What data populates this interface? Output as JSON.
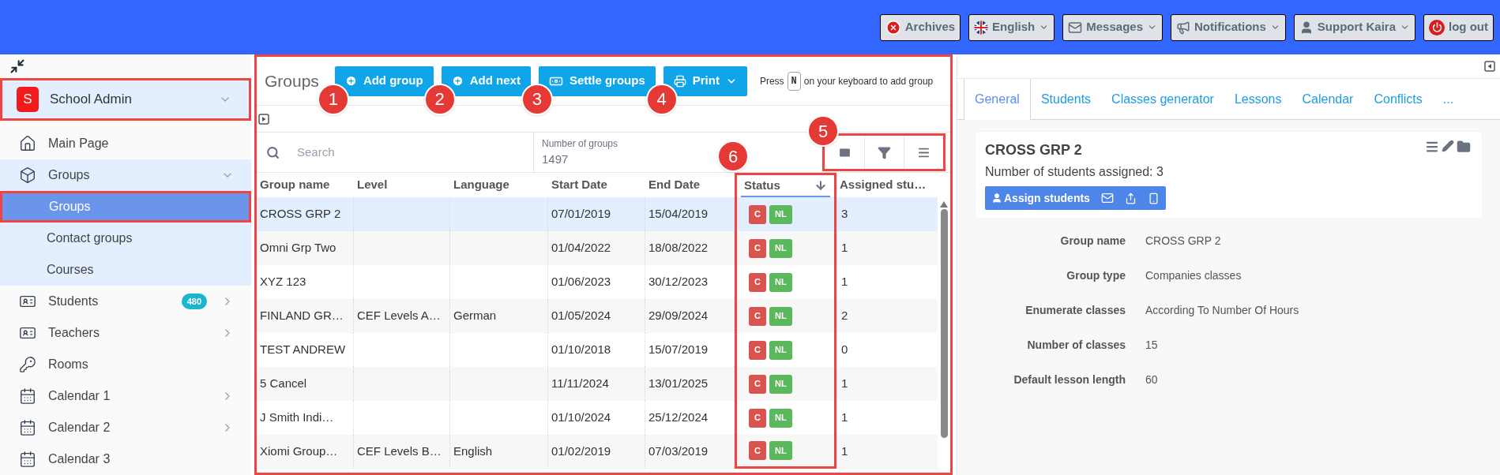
{
  "top_bar": {
    "buttons": [
      {
        "kind": "archives",
        "label": "Archives",
        "dropdown": false
      },
      {
        "kind": "language",
        "label": "English",
        "dropdown": true
      },
      {
        "kind": "messages",
        "label": "Messages",
        "dropdown": true
      },
      {
        "kind": "notifications",
        "label": "Notifications",
        "dropdown": true
      },
      {
        "kind": "user",
        "label": "Support Kaira",
        "dropdown": true
      },
      {
        "kind": "logout",
        "label": "log out",
        "dropdown": false
      }
    ]
  },
  "sidebar": {
    "header": {
      "initial": "S",
      "title": "School Admin",
      "highlighted": true
    },
    "items": [
      {
        "kind": "home",
        "label": "Main Page"
      },
      {
        "kind": "box",
        "label": "Groups",
        "expanded": true,
        "children": [
          {
            "label": "Groups",
            "selected": true,
            "highlighted": true
          },
          {
            "label": "Contact groups",
            "selected": false,
            "highlighted": false
          },
          {
            "label": "Courses",
            "selected": false,
            "highlighted": false
          }
        ]
      },
      {
        "kind": "card",
        "label": "Students",
        "badge": "480",
        "expanded": false
      },
      {
        "kind": "card",
        "label": "Teachers",
        "expanded": false
      },
      {
        "kind": "key",
        "label": "Rooms"
      },
      {
        "kind": "calendar",
        "label": "Calendar 1",
        "expanded": false
      },
      {
        "kind": "calendar",
        "label": "Calendar 2",
        "expanded": false
      },
      {
        "kind": "calendar",
        "label": "Calendar 3"
      }
    ]
  },
  "groups_panel": {
    "highlighted": true,
    "title": "Groups",
    "buttons": [
      {
        "kind": "add",
        "label": "Add group",
        "callout": "1",
        "dropdown": false
      },
      {
        "kind": "add",
        "label": "Add next",
        "callout": "2",
        "dropdown": false
      },
      {
        "kind": "money",
        "label": "Settle groups",
        "callout": "3",
        "dropdown": false
      },
      {
        "kind": "print",
        "label": "Print",
        "callout": "4",
        "dropdown": true
      }
    ],
    "hint": {
      "before": "Press",
      "key": "N",
      "after": "on your keyboard to add group"
    },
    "search": {
      "placeholder": "Search"
    },
    "count": {
      "label": "Number of groups",
      "value": "1497"
    },
    "tools": {
      "highlighted": true,
      "callout": "5"
    },
    "table": {
      "columns": [
        {
          "label": "Group name",
          "sorted": false,
          "highlighted": false
        },
        {
          "label": "Level",
          "sorted": false,
          "highlighted": false
        },
        {
          "label": "Language",
          "sorted": false,
          "highlighted": false
        },
        {
          "label": "Start Date",
          "sorted": false,
          "highlighted": false
        },
        {
          "label": "End Date",
          "sorted": false,
          "highlighted": false
        },
        {
          "label": "Status",
          "sorted": true,
          "highlighted": true,
          "callout": "6"
        },
        {
          "label": "Assigned stu…",
          "sorted": false,
          "highlighted": false
        }
      ],
      "rows": [
        {
          "selected": true,
          "cells": [
            "CROSS GRP 2",
            "",
            "",
            "07/01/2019",
            "15/04/2019"
          ],
          "status": [
            {
              "text": "C",
              "color": "#d9534f"
            },
            {
              "text": "NL",
              "color": "#5cb85c"
            }
          ],
          "assigned": "3"
        },
        {
          "selected": false,
          "cells": [
            "Omni Grp Two",
            "",
            "",
            "01/04/2022",
            "18/08/2022"
          ],
          "status": [
            {
              "text": "C",
              "color": "#d9534f"
            },
            {
              "text": "NL",
              "color": "#5cb85c"
            }
          ],
          "assigned": "1"
        },
        {
          "selected": false,
          "cells": [
            "XYZ 123",
            "",
            "",
            "01/06/2023",
            "30/12/2023"
          ],
          "status": [
            {
              "text": "C",
              "color": "#d9534f"
            },
            {
              "text": "NL",
              "color": "#5cb85c"
            }
          ],
          "assigned": "1"
        },
        {
          "selected": false,
          "cells": [
            "FINLAND GR…",
            "CEF Levels A…",
            "German",
            "01/05/2024",
            "29/09/2024"
          ],
          "status": [
            {
              "text": "C",
              "color": "#d9534f"
            },
            {
              "text": "NL",
              "color": "#5cb85c"
            }
          ],
          "assigned": "2"
        },
        {
          "selected": false,
          "cells": [
            "TEST ANDREW",
            "",
            "",
            "01/10/2018",
            "15/07/2019"
          ],
          "status": [
            {
              "text": "C",
              "color": "#d9534f"
            },
            {
              "text": "NL",
              "color": "#5cb85c"
            }
          ],
          "assigned": "0"
        },
        {
          "selected": false,
          "cells": [
            "5 Cancel",
            "",
            "",
            "11/11/2024",
            "13/01/2025"
          ],
          "status": [
            {
              "text": "C",
              "color": "#d9534f"
            },
            {
              "text": "NL",
              "color": "#5cb85c"
            }
          ],
          "assigned": "1"
        },
        {
          "selected": false,
          "cells": [
            "J Smith Indi…",
            "",
            "",
            "01/10/2024",
            "25/12/2024"
          ],
          "status": [
            {
              "text": "C",
              "color": "#d9534f"
            },
            {
              "text": "NL",
              "color": "#5cb85c"
            }
          ],
          "assigned": "1"
        },
        {
          "selected": false,
          "cells": [
            "Xiomi Group…",
            "CEF Levels B…",
            "English",
            "01/02/2019",
            "07/03/2019"
          ],
          "status": [
            {
              "text": "C",
              "color": "#d9534f"
            },
            {
              "text": "NL",
              "color": "#5cb85c"
            }
          ],
          "assigned": "1"
        }
      ]
    }
  },
  "detail_panel": {
    "tabs": [
      {
        "label": "General",
        "selected": true
      },
      {
        "label": "Students",
        "selected": false
      },
      {
        "label": "Classes generator",
        "selected": false
      },
      {
        "label": "Lessons",
        "selected": false
      },
      {
        "label": "Calendar",
        "selected": false
      },
      {
        "label": "Conflicts",
        "selected": false
      },
      {
        "label": "...",
        "selected": false
      }
    ],
    "card": {
      "title": "CROSS GRP 2",
      "subtitle": "Number of students assigned: 3",
      "button": "Assign students"
    },
    "fields": [
      {
        "label": "Group name",
        "value": "CROSS GRP 2"
      },
      {
        "label": "Group type",
        "value": "Companies classes"
      },
      {
        "label": "Enumerate classes",
        "value": "According To Number Of Hours"
      },
      {
        "label": "Number of classes",
        "value": "15"
      },
      {
        "label": "Default lesson length",
        "value": "60"
      }
    ]
  }
}
